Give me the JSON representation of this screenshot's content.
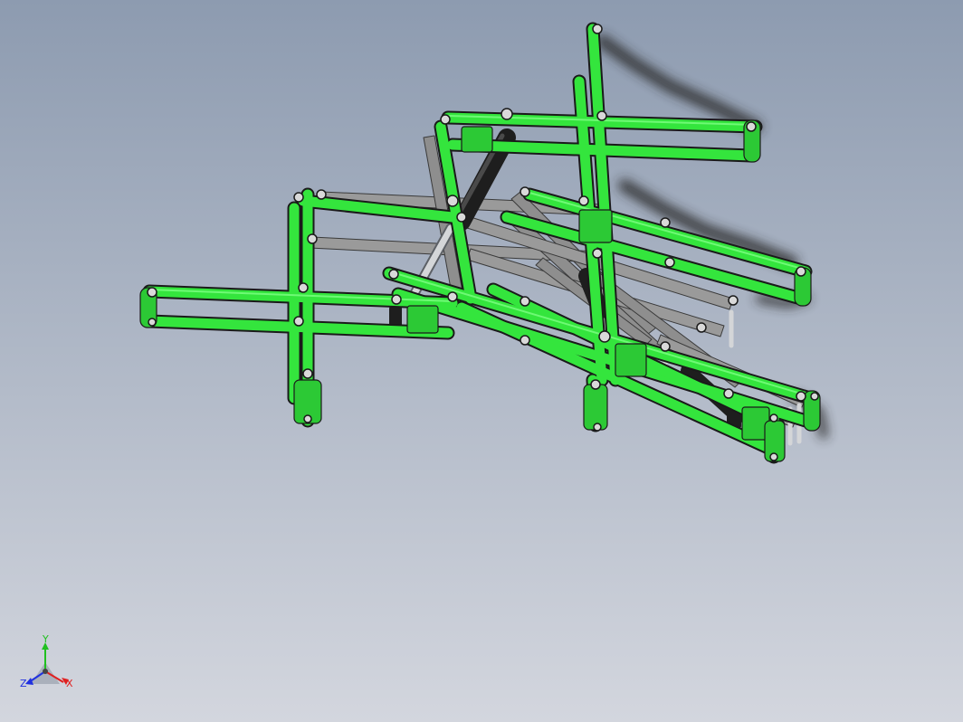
{
  "viewport": {
    "background_top": "#8d9bb0",
    "background_bottom": "#d3d6de",
    "model_color": "#34e53d",
    "model_dark": "#1d9a26",
    "link_color": "#9a9a9a",
    "cylinder_color": "#1e1e1e",
    "rod_color": "#d4d6d8"
  },
  "triad": {
    "x_label": "X",
    "y_label": "Y",
    "z_label": "Z",
    "x_color": "#e02020",
    "y_color": "#20c020",
    "z_color": "#2030e0"
  }
}
